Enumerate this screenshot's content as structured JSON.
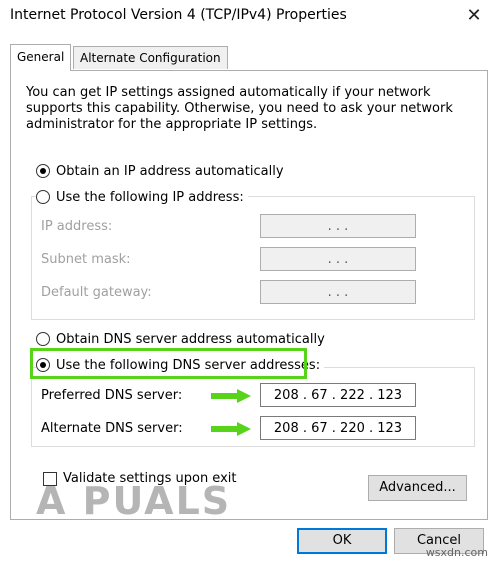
{
  "window": {
    "title": "Internet Protocol Version 4 (TCP/IPv4) Properties",
    "close_glyph": "✕"
  },
  "tabs": [
    {
      "label": "General",
      "active": true
    },
    {
      "label": "Alternate Configuration",
      "active": false
    }
  ],
  "description": "You can get IP settings assigned automatically if your network supports this capability. Otherwise, you need to ask your network administrator for the appropriate IP settings.",
  "ip": {
    "auto_label": "Obtain an IP address automatically",
    "manual_label": "Use the following IP address:",
    "selected": "auto",
    "fields": [
      {
        "label": "IP address:",
        "value": ". . ."
      },
      {
        "label": "Subnet mask:",
        "value": ". . ."
      },
      {
        "label": "Default gateway:",
        "value": ". . ."
      }
    ]
  },
  "dns": {
    "auto_label": "Obtain DNS server address automatically",
    "manual_label": "Use the following DNS server addresses:",
    "selected": "manual",
    "preferred": {
      "label": "Preferred DNS server:",
      "value": "208 . 67 . 222 . 123"
    },
    "alternate": {
      "label": "Alternate DNS server:",
      "value": "208 . 67 . 220 . 123"
    }
  },
  "validate_label": "Validate settings upon exit",
  "validate_checked": false,
  "buttons": {
    "advanced": "Advanced...",
    "ok": "OK",
    "cancel": "Cancel"
  },
  "watermark": "A PUALS",
  "site": "wsxdn.com",
  "colors": {
    "highlight": "#57d41a",
    "accent": "#0078d7"
  }
}
